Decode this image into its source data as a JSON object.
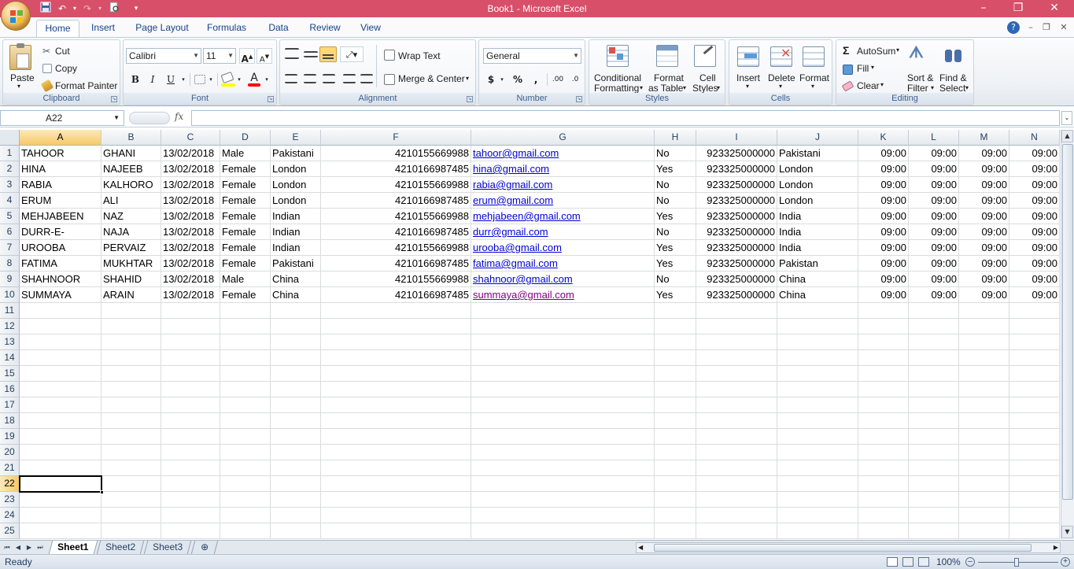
{
  "window": {
    "title": "Book1 - Microsoft Excel",
    "minimize": "–",
    "restore": "❐",
    "close": "✕"
  },
  "qat": {
    "save_icon": "save-icon",
    "undo_icon": "undo-icon",
    "redo_icon": "redo-icon",
    "print_preview_icon": "print-preview-icon",
    "customize_icon": "customize-qat-icon"
  },
  "tabs": [
    {
      "label": "Home",
      "active": true
    },
    {
      "label": "Insert"
    },
    {
      "label": "Page Layout"
    },
    {
      "label": "Formulas"
    },
    {
      "label": "Data"
    },
    {
      "label": "Review"
    },
    {
      "label": "View"
    }
  ],
  "ribbon": {
    "clipboard": {
      "label": "Clipboard",
      "paste": "Paste",
      "cut": "Cut",
      "copy": "Copy",
      "format_painter": "Format Painter"
    },
    "font": {
      "label": "Font",
      "family": "Calibri",
      "size": "11",
      "bold": "B",
      "italic": "I",
      "underline": "U",
      "grow": "A",
      "shrink": "A"
    },
    "alignment": {
      "label": "Alignment",
      "wrap_text": "Wrap Text",
      "merge_center": "Merge & Center"
    },
    "number": {
      "label": "Number",
      "format": "General",
      "currency": "$",
      "percent": "%",
      "comma": ",",
      "inc_decimal": ".00",
      "dec_decimal": ".0"
    },
    "styles": {
      "label": "Styles",
      "conditional_1": "Conditional",
      "conditional_2": "Formatting",
      "format_table_1": "Format",
      "format_table_2": "as Table",
      "cell_styles_1": "Cell",
      "cell_styles_2": "Styles"
    },
    "cells": {
      "label": "Cells",
      "insert": "Insert",
      "delete": "Delete",
      "format": "Format"
    },
    "editing": {
      "label": "Editing",
      "autosum": "AutoSum",
      "fill": "Fill",
      "clear": "Clear",
      "sort_1": "Sort &",
      "sort_2": "Filter",
      "find_1": "Find &",
      "find_2": "Select"
    }
  },
  "formula_bar": {
    "name_box": "A22",
    "fx": "fx",
    "value": ""
  },
  "columns": [
    "A",
    "B",
    "C",
    "D",
    "E",
    "F",
    "G",
    "H",
    "I",
    "J",
    "K",
    "L",
    "M",
    "N"
  ],
  "active_cell": {
    "col": "A",
    "row": 22
  },
  "rows": [
    [
      "TAHOOR",
      "GHANI",
      "13/02/2018",
      "Male",
      "Pakistani",
      "4210155669988",
      "tahoor@gmail.com",
      "No",
      "923325000000",
      "Pakistani",
      "09:00",
      "09:00",
      "09:00",
      "09:00"
    ],
    [
      "HINA",
      "NAJEEB",
      "13/02/2018",
      "Female",
      "London",
      "4210166987485",
      "hina@gmail.com",
      "Yes",
      "923325000000",
      "London",
      "09:00",
      "09:00",
      "09:00",
      "09:00"
    ],
    [
      "RABIA",
      "KALHORO",
      "13/02/2018",
      "Female",
      "London",
      "4210155669988",
      "rabia@gmail.com",
      "No",
      "923325000000",
      "London",
      "09:00",
      "09:00",
      "09:00",
      "09:00"
    ],
    [
      "ERUM",
      "ALI",
      "13/02/2018",
      "Female",
      "London",
      "4210166987485",
      "erum@gmail.com",
      "No",
      "923325000000",
      "London",
      "09:00",
      "09:00",
      "09:00",
      "09:00"
    ],
    [
      "MEHJABEEN",
      "NAZ",
      "13/02/2018",
      "Female",
      "Indian",
      "4210155669988",
      "mehjabeen@gmail.com",
      "Yes",
      "923325000000",
      "India",
      "09:00",
      "09:00",
      "09:00",
      "09:00"
    ],
    [
      "DURR-E-",
      "NAJA",
      "13/02/2018",
      "Female",
      "Indian",
      "4210166987485",
      "durr@gmail.com",
      "No",
      "923325000000",
      "India",
      "09:00",
      "09:00",
      "09:00",
      "09:00"
    ],
    [
      "UROOBA",
      "PERVAIZ",
      "13/02/2018",
      "Female",
      "Indian",
      "4210155669988",
      "urooba@gmail.com",
      "Yes",
      "923325000000",
      "India",
      "09:00",
      "09:00",
      "09:00",
      "09:00"
    ],
    [
      "FATIMA",
      "MUKHTAR",
      "13/02/2018",
      "Female",
      "Pakistani",
      "4210166987485",
      "fatima@gmail.com",
      "Yes",
      "923325000000",
      "Pakistan",
      "09:00",
      "09:00",
      "09:00",
      "09:00"
    ],
    [
      "SHAHNOOR",
      "SHAHID",
      "13/02/2018",
      "Male",
      "China",
      "4210155669988",
      "shahnoor@gmail.com",
      "No",
      "923325000000",
      "China",
      "09:00",
      "09:00",
      "09:00",
      "09:00"
    ],
    [
      "SUMMAYA",
      "ARAIN",
      "13/02/2018",
      "Female",
      "China",
      "4210166987485",
      "summaya@gmail.com",
      "Yes",
      "923325000000",
      "China",
      "09:00",
      "09:00",
      "09:00",
      "09:00"
    ]
  ],
  "row_count": 25,
  "sheets": [
    {
      "label": "Sheet1",
      "active": true
    },
    {
      "label": "Sheet2"
    },
    {
      "label": "Sheet3"
    }
  ],
  "status": {
    "mode": "Ready",
    "zoom": "100%"
  },
  "colors": {
    "title_bar": "#d84f69",
    "hyperlink": "#0000d4",
    "visited_link": "#800080",
    "selected_header": "#f7c867"
  }
}
